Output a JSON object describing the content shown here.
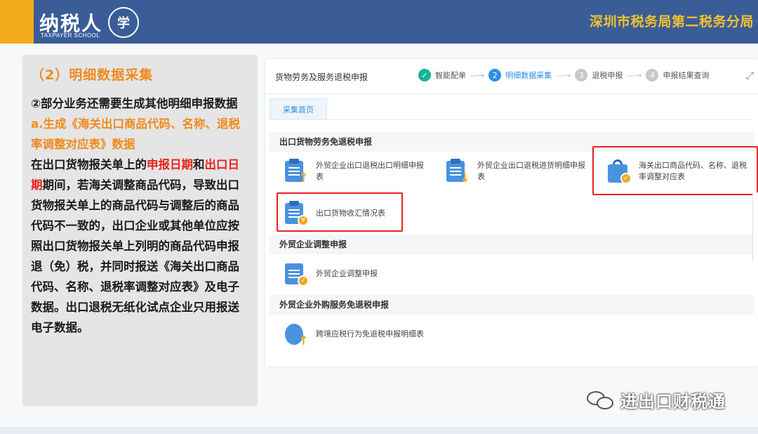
{
  "banner": {
    "logo_text": "纳税人",
    "logo_sub": "TAXPAYER SCHOOL",
    "logo_emblem": "学",
    "org_name": "深圳市税务局第二税务分局"
  },
  "left": {
    "section_title": "（2）明细数据采集",
    "point": "②部分业务还需要生成其他明细申报数据",
    "sub_title": "a.生成《海关出口商品代码、名称、退税率调整对应表》数据",
    "para_a": "在出口货物报关单上的",
    "para_red1": "申报日期",
    "para_b": "和",
    "para_red2": "出口日期",
    "para_c": "期间，若海关调整商品代码，导致出口货物报关单上的商品代码与调整后的商品代码不一致的，出口企业或其他单位应按照出口货物报关单上列明的商品代码申报退（免）税，并同时报送《海关出口商品代码、名称、退税率调整对应表》及电子数据。出口退税无纸化试点企业只用报送电子数据。"
  },
  "app": {
    "title": "货物劳务及服务退税申报",
    "steps": [
      {
        "num": "✓",
        "label": "智能配单"
      },
      {
        "num": "2",
        "label": "明细数据采集"
      },
      {
        "num": "3",
        "label": "退税申报"
      },
      {
        "num": "4",
        "label": "申报结果查询"
      }
    ],
    "tab": "采集首页",
    "groups": {
      "g1": "出口货物劳务免退税申报",
      "g2": "外贸企业调整申报",
      "g3": "外贸企业外购服务免退税申报"
    },
    "items": {
      "i1": "外贸企业出口退税出口明细申报表",
      "i2": "外贸企业出口退税进货明细申报表",
      "i3": "海关出口商品代码、名称、退税率调整对应表",
      "i4": "出口货物收汇情况表",
      "i5": "外贸企业调整申报",
      "i6": "跨境应税行为免退税申报明细表"
    },
    "highlight_color": "#e8221d"
  },
  "watermark": {
    "text": "进出口财税通"
  },
  "colors": {
    "banner": "#3a5d98",
    "accent": "#f2ac1a",
    "org_name": "#f4c22e",
    "orange": "#f08a1e",
    "red": "#e8221d",
    "blue": "#2e8de6",
    "green": "#1ab394"
  }
}
